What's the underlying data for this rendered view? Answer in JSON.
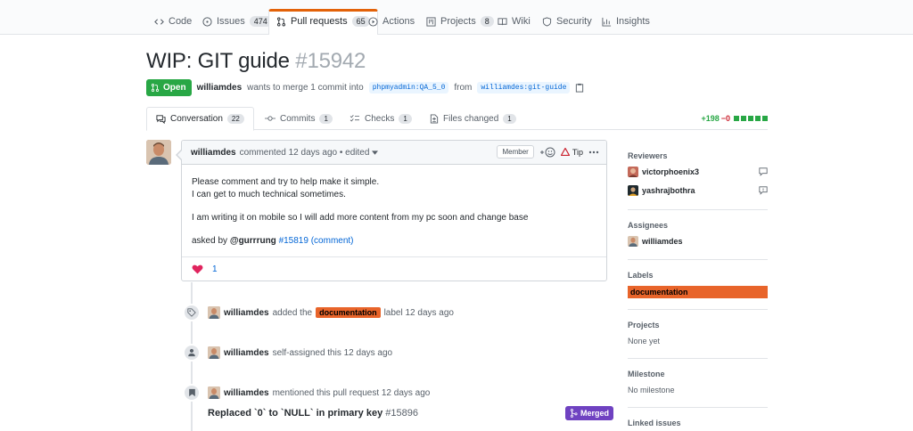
{
  "repo_nav": {
    "tabs": [
      {
        "label": "Code",
        "icon": "code-icon"
      },
      {
        "label": "Issues",
        "count": "474",
        "icon": "issue-opened-icon"
      },
      {
        "label": "Pull requests",
        "count": "65",
        "icon": "git-pull-request-icon"
      },
      {
        "label": "Actions",
        "icon": "play-icon"
      },
      {
        "label": "Projects",
        "count": "8",
        "icon": "project-icon"
      },
      {
        "label": "Wiki",
        "icon": "book-icon"
      },
      {
        "label": "Security",
        "icon": "shield-icon"
      },
      {
        "label": "Insights",
        "icon": "graph-icon"
      }
    ]
  },
  "pr": {
    "title": "WIP: GIT guide",
    "number": "#15942",
    "state": "Open",
    "author": "williamdes",
    "merge_text": "wants to merge 1 commit into",
    "base_branch": "phpmyadmin:QA_5_0",
    "from_text": "from",
    "head_branch": "williamdes:git-guide"
  },
  "tabs": [
    {
      "label": "Conversation",
      "count": "22"
    },
    {
      "label": "Commits",
      "count": "1"
    },
    {
      "label": "Checks",
      "count": "1"
    },
    {
      "label": "Files changed",
      "count": "1"
    }
  ],
  "diffstat": {
    "additions": "+198",
    "deletions": "−0"
  },
  "comment": {
    "author": "williamdes",
    "meta": "commented 12 days ago • edited",
    "role": "Member",
    "tip": "Tip",
    "line1": "Please comment and try to help make it simple.",
    "line2": "I can get to much technical sometimes.",
    "para2": "I am writing it on mobile so I will add more content from my pc soon and change base",
    "asked_by": "asked by",
    "asker": "@gurrrung",
    "ref_issue": "#15819",
    "ref_comment": "(comment)",
    "reaction_count": "1"
  },
  "timeline": {
    "labeled": {
      "user": "williamdes",
      "pre": "added the",
      "label": "documentation",
      "post": "label 12 days ago"
    },
    "assigned": {
      "user": "williamdes",
      "text": "self-assigned this 12 days ago"
    },
    "mentioned": {
      "user": "williamdes",
      "text": "mentioned this pull request 12 days ago"
    },
    "ref_title": "Replaced `0` to `NULL` in primary key",
    "ref_number": "#15896",
    "ref_state": "Merged"
  },
  "sidebar": {
    "reviewers_heading": "Reviewers",
    "reviewers": [
      "victorphoenix3",
      "yashrajbothra"
    ],
    "assignees_heading": "Assignees",
    "assignee": "williamdes",
    "labels_heading": "Labels",
    "label": "documentation",
    "projects_heading": "Projects",
    "projects_value": "None yet",
    "milestone_heading": "Milestone",
    "milestone_value": "No milestone",
    "linked_heading": "Linked issues"
  },
  "colors": {
    "accent_orange": "#e36209",
    "open_green": "#28a745",
    "merged_purple": "#6f42c1",
    "link_blue": "#0366d6",
    "label_doc": "#e8642a"
  }
}
